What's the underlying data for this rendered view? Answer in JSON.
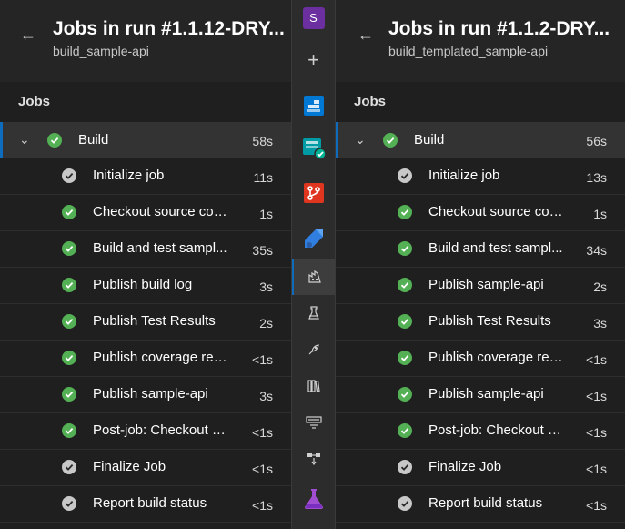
{
  "left": {
    "title": "Jobs in run #1.1.12-DRY...",
    "subtitle": "build_sample-api",
    "section": "Jobs",
    "job": {
      "name": "Build",
      "duration": "58s"
    },
    "steps": [
      {
        "name": "Initialize job",
        "duration": "11s",
        "status": "gray"
      },
      {
        "name": "Checkout source code",
        "duration": "1s",
        "status": "green"
      },
      {
        "name": "Build and test sampl...",
        "duration": "35s",
        "status": "green"
      },
      {
        "name": "Publish build log",
        "duration": "3s",
        "status": "green"
      },
      {
        "name": "Publish Test Results",
        "duration": "2s",
        "status": "green"
      },
      {
        "name": "Publish coverage rep...",
        "duration": "<1s",
        "status": "green"
      },
      {
        "name": "Publish sample-api",
        "duration": "3s",
        "status": "green"
      },
      {
        "name": "Post-job: Checkout s...",
        "duration": "<1s",
        "status": "green"
      },
      {
        "name": "Finalize Job",
        "duration": "<1s",
        "status": "gray"
      },
      {
        "name": "Report build status",
        "duration": "<1s",
        "status": "gray"
      }
    ]
  },
  "right": {
    "title": "Jobs in run #1.1.2-DRY...",
    "subtitle": "build_templated_sample-api",
    "section": "Jobs",
    "job": {
      "name": "Build",
      "duration": "56s"
    },
    "steps": [
      {
        "name": "Initialize job",
        "duration": "13s",
        "status": "gray"
      },
      {
        "name": "Checkout source code",
        "duration": "1s",
        "status": "green"
      },
      {
        "name": "Build and test sampl...",
        "duration": "34s",
        "status": "green"
      },
      {
        "name": "Publish sample-api",
        "duration": "2s",
        "status": "green"
      },
      {
        "name": "Publish Test Results",
        "duration": "3s",
        "status": "green"
      },
      {
        "name": "Publish coverage rep...",
        "duration": "<1s",
        "status": "green"
      },
      {
        "name": "Publish sample-api",
        "duration": "<1s",
        "status": "green"
      },
      {
        "name": "Post-job: Checkout s...",
        "duration": "<1s",
        "status": "green"
      },
      {
        "name": "Finalize Job",
        "duration": "<1s",
        "status": "gray"
      },
      {
        "name": "Report build status",
        "duration": "<1s",
        "status": "gray"
      }
    ]
  },
  "rail": {
    "avatar_letter": "S",
    "icons": [
      "project-avatar",
      "plus-icon",
      "boards-icon",
      "test-plans-icon",
      "repos-icon",
      "pipelines-icon",
      "pipelines-runs-icon",
      "environments-icon",
      "releases-icon",
      "library-icon",
      "task-groups-icon",
      "deployment-groups-icon",
      "artifacts-icon"
    ],
    "active_icon": "pipelines-runs-icon"
  },
  "colors": {
    "success": "#54b054",
    "neutral": "#c8c8c8",
    "accent": "#0f6cbd"
  }
}
